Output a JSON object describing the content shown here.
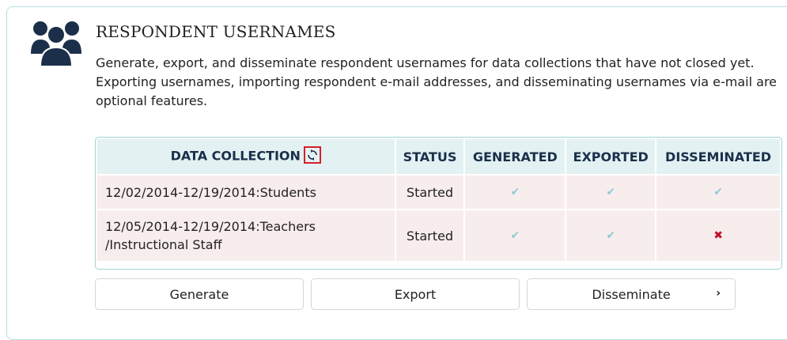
{
  "section": {
    "title": "RESPONDENT USERNAMES",
    "description": "Generate, export, and disseminate respondent usernames for data collections that have not closed yet. Exporting usernames, importing respondent e-mail addresses, and disseminating usernames via e-mail are optional features.",
    "icon": "people-group-icon"
  },
  "table": {
    "headers": {
      "collection": "DATA COLLECTION",
      "status": "STATUS",
      "generated": "GENERATED",
      "exported": "EXPORTED",
      "disseminated": "DISSEMINATED"
    },
    "refresh_icon": "refresh-icon",
    "rows": [
      {
        "collection": "12/02/2014-12/19/2014:Students",
        "status": "Started",
        "generated": "✔",
        "exported": "✔",
        "disseminated": "✔"
      },
      {
        "collection_line1": "12/05/2014-12/19/2014:Teachers",
        "collection_line2": "/Instructional Staff",
        "status": "Started",
        "generated": "✔",
        "exported": "✔",
        "disseminated": "✖"
      }
    ]
  },
  "buttons": {
    "generate": "Generate",
    "export": "Export",
    "disseminate": "Disseminate",
    "disseminate_chevron": "›"
  },
  "colors": {
    "accent_navy": "#1b2f4a",
    "header_bg": "#e3f1f3",
    "row_bg": "#f8eded",
    "check": "#8fcbd2",
    "cross": "#c0102a",
    "highlight": "#d4202a"
  }
}
